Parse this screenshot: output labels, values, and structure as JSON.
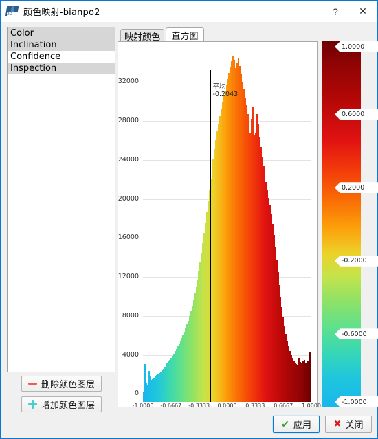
{
  "window": {
    "title": "颜色映射-bianpo2",
    "icon": "app-3d-icon",
    "help_label": "?",
    "close_label": "✕"
  },
  "sidebar": {
    "items": [
      {
        "label": "Color",
        "shaded": true
      },
      {
        "label": "Inclination",
        "shaded": true
      },
      {
        "label": "Confidence",
        "shaded": false
      },
      {
        "label": "Inspection",
        "shaded": true
      }
    ],
    "buttons": [
      {
        "label": "删除颜色图层",
        "sign": "minus",
        "color": "#f2595b"
      },
      {
        "label": "增加颜色图层",
        "sign": "plus",
        "color": "#49cfc8"
      }
    ]
  },
  "tabs": [
    {
      "label": "映射颜色",
      "active": false
    },
    {
      "label": "直方图",
      "active": true
    }
  ],
  "dialog_buttons": {
    "apply": {
      "label": "应用",
      "icon": "check-icon",
      "color": "#2aa02a"
    },
    "close": {
      "label": "关闭",
      "icon": "cross-icon",
      "color": "#d61f1f"
    }
  },
  "colorbar": {
    "labels": [
      "1.0000",
      "0.6000",
      "0.2000",
      "-0.2000",
      "-0.6000",
      "-1.0000"
    ],
    "values": [
      1.0,
      0.6,
      0.2,
      -0.2,
      -0.6,
      -1.0
    ],
    "top_color": "#6e0000",
    "bottom_color": "#19b6ec"
  },
  "chart_data": {
    "type": "bar",
    "title": "",
    "xlabel": "",
    "ylabel": "",
    "xlim": [
      -1.0,
      1.0
    ],
    "ylim": [
      0,
      35500
    ],
    "grid": true,
    "legend": false,
    "xtick_labels": [
      "-1.0000",
      "-0.6667",
      "-0.3333",
      "0.0000",
      "0.3333",
      "0.6667",
      "1.0000"
    ],
    "xtick_values": [
      -1.0,
      -0.6667,
      -0.3333,
      0.0,
      0.3333,
      0.6667,
      1.0
    ],
    "ytick_labels": [
      "4000",
      "8000",
      "12000",
      "16000",
      "20000",
      "24000",
      "28000",
      "32000"
    ],
    "ytick_values": [
      4000,
      8000,
      12000,
      16000,
      20000,
      24000,
      28000,
      32000
    ],
    "annotations": [
      {
        "name": "mean",
        "label": "平均",
        "value_label": "-0.2043",
        "value": -0.2043,
        "style": "vertical-line"
      }
    ],
    "bin_count": 128,
    "values": [
      200,
      3100,
      1200,
      900,
      2400,
      1800,
      1500,
      1600,
      1700,
      1850,
      1950,
      2050,
      2150,
      2300,
      2450,
      2600,
      2800,
      3000,
      3150,
      3350,
      3550,
      3750,
      3950,
      4150,
      4400,
      4650,
      4900,
      5150,
      5450,
      5750,
      6050,
      6400,
      6750,
      7150,
      7550,
      8000,
      8500,
      9050,
      9650,
      10300,
      11000,
      11750,
      12600,
      13500,
      14450,
      15450,
      16500,
      17600,
      18700,
      19800,
      20900,
      22000,
      23100,
      24100,
      25100,
      26000,
      26900,
      27700,
      28500,
      29200,
      29900,
      30500,
      31100,
      31700,
      32300,
      32900,
      33500,
      34100,
      34600,
      34200,
      33400,
      33900,
      34400,
      33600,
      32800,
      32000,
      31200,
      30400,
      29600,
      28700,
      27800,
      26800,
      28200,
      29400,
      26500,
      26800,
      28700,
      27600,
      26300,
      25300,
      24300,
      23400,
      22500,
      21700,
      20900,
      20100,
      19300,
      18400,
      17400,
      16300,
      15100,
      13800,
      12500,
      11200,
      10000,
      8900,
      7900,
      7000,
      6200,
      5500,
      4900,
      4400,
      4000,
      3700,
      3450,
      3250,
      3100,
      2950,
      3700,
      3300,
      3200,
      3350,
      3500,
      3200,
      3100,
      3400,
      4300,
      3900
    ]
  }
}
